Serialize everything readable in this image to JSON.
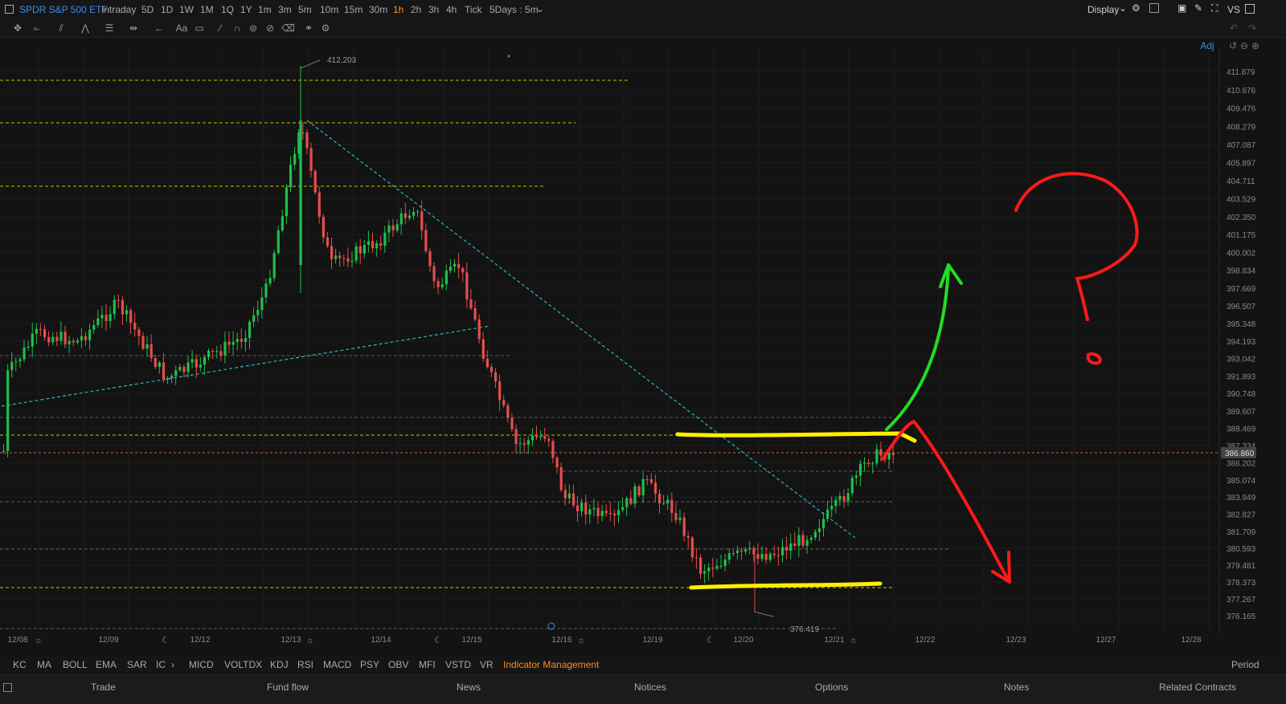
{
  "header": {
    "symbol": "SPDR S&P 500 ETF",
    "periods": [
      "Intraday",
      "5D",
      "1D",
      "1W",
      "1M",
      "1Q",
      "1Y",
      "1m",
      "3m",
      "5m",
      "10m",
      "15m",
      "30m",
      "1h",
      "2h",
      "3h",
      "4h",
      "Tick",
      "5Days : 5m"
    ],
    "active_period": "1h",
    "display_label": "Display",
    "vs_label": "VS"
  },
  "chart": {
    "adj_label": "Adj",
    "price_axis": [
      "411.879",
      "410.676",
      "409.476",
      "408.279",
      "407.087",
      "405.897",
      "404.711",
      "403.529",
      "402.350",
      "401.175",
      "400.002",
      "398.834",
      "397.669",
      "396.507",
      "395.348",
      "394.193",
      "393.042",
      "391.893",
      "390.748",
      "389.607",
      "388.469",
      "387.334",
      "386.202",
      "385.074",
      "383.949",
      "382.827",
      "381.709",
      "380.593",
      "379.481",
      "378.373",
      "377.267",
      "376.165"
    ],
    "current_price": "386.860",
    "high_label": "412.203",
    "low_label": "376.419",
    "date_axis": [
      "12/08",
      "12/09",
      "12/12",
      "12/13",
      "12/14",
      "12/15",
      "12/16",
      "12/19",
      "12/20",
      "12/21",
      "12/22",
      "12/23",
      "12/27",
      "12/28"
    ],
    "colors": {
      "up": "#1fbf4a",
      "down": "#e84c4c",
      "yellow": "#ffee00",
      "cyan": "#29b8c8",
      "green_arrow": "#22dd22",
      "red_arrow": "#ff1a1a"
    }
  },
  "indicators": {
    "items": [
      "KC",
      "MA",
      "BOLL",
      "EMA",
      "SAR",
      "IC",
      "MICD",
      "VOLTDX",
      "KDJ",
      "RSI",
      "MACD",
      "PSY",
      "OBV",
      "MFI",
      "VSTD",
      "VR"
    ],
    "management": "Indicator Management",
    "period": "Period"
  },
  "bottom_tabs": [
    "Trade",
    "Fund flow",
    "News",
    "Notices",
    "Options",
    "Notes",
    "Related Contracts"
  ]
}
